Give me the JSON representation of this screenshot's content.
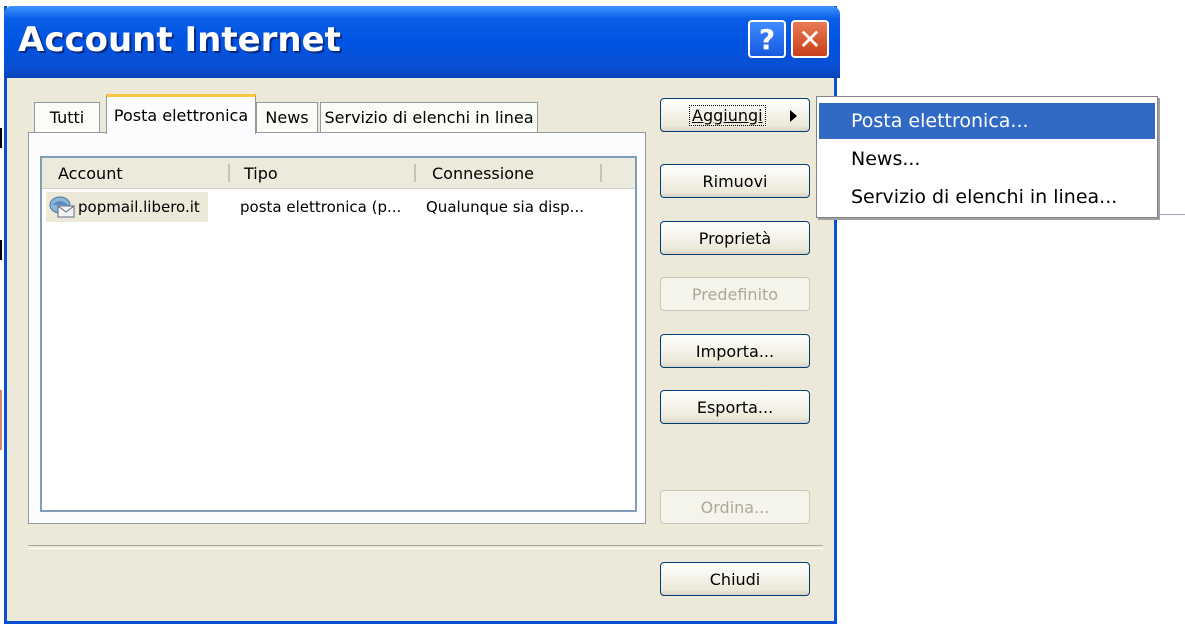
{
  "window": {
    "title": "Account Internet",
    "help_glyph": "?",
    "close_glyph": "✕"
  },
  "tabs": [
    {
      "label": "Tutti",
      "selected": false
    },
    {
      "label": "Posta elettronica",
      "selected": true
    },
    {
      "label": "News",
      "selected": false
    },
    {
      "label": "Servizio di elenchi in linea",
      "selected": false
    }
  ],
  "list": {
    "columns": [
      "Account",
      "Tipo",
      "Connessione"
    ],
    "rows": [
      {
        "account": "popmail.libero.it",
        "tipo": "posta elettronica (p...",
        "connessione": "Qualunque sia disp..."
      }
    ]
  },
  "buttons": {
    "aggiungi": "Aggiungi",
    "rimuovi": "Rimuovi",
    "proprieta": "Proprietà",
    "predefinito": "Predefinito",
    "importa": "Importa...",
    "esporta": "Esporta...",
    "ordina": "Ordina...",
    "chiudi": "Chiudi"
  },
  "menu": {
    "items": [
      {
        "label": "Posta elettronica...",
        "selected": true
      },
      {
        "label": "News...",
        "selected": false
      },
      {
        "label": "Servizio di elenchi in linea...",
        "selected": false
      }
    ]
  },
  "colors": {
    "titlebar": "#0054e3",
    "menu_highlight": "#316ac5",
    "dialog_bg": "#ece9d8",
    "tab_accent": "#ffc83c"
  },
  "icons": {
    "account_icon": "mail-account-icon",
    "submenu_arrow": "arrow-right-icon"
  }
}
